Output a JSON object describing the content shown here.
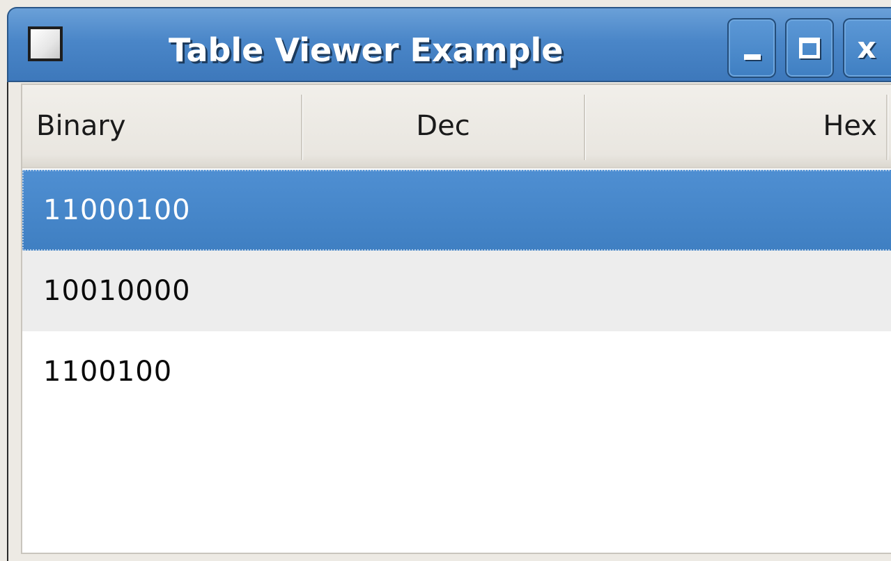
{
  "window": {
    "title": "Table Viewer Example",
    "icon": "app-window-icon",
    "controls": {
      "minimize_icon": "minimize-icon",
      "maximize_icon": "maximize-icon",
      "close_label": "x"
    },
    "accent_color": "#4a86c8"
  },
  "table": {
    "columns": [
      "Binary",
      "Dec",
      "Hex"
    ],
    "rows": [
      {
        "binary": "11000100",
        "dec": "",
        "hex": "",
        "selected": true
      },
      {
        "binary": "10010000",
        "dec": "",
        "hex": "",
        "selected": false
      },
      {
        "binary": "1100100",
        "dec": "",
        "hex": "",
        "selected": false
      }
    ],
    "selection_color": "#4a86c8"
  }
}
